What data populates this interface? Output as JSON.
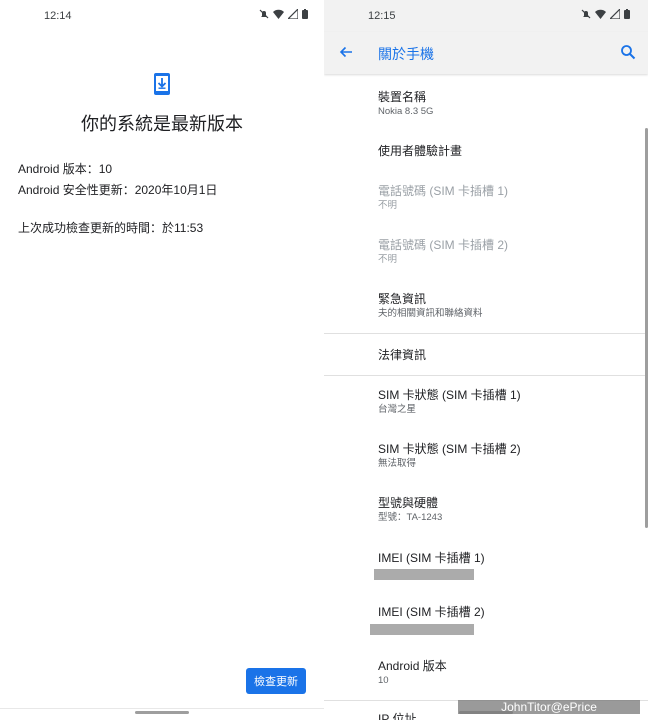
{
  "left": {
    "status": {
      "time": "12:14"
    },
    "title": "你的系統是最新版本",
    "android_version": "Android 版本：10",
    "security_update": "Android 安全性更新：2020年10月1日",
    "last_check": "上次成功檢查更新的時間：於11:53",
    "check_button": "檢查更新"
  },
  "right": {
    "status": {
      "time": "12:15"
    },
    "appbar_title": "關於手機",
    "items": [
      {
        "title": "裝置名稱",
        "subtitle": "Nokia 8.3 5G"
      },
      {
        "title": "使用者體驗計畫",
        "subtitle": ""
      },
      {
        "title": "電話號碼 (SIM 卡插槽 1)",
        "subtitle": "不明"
      },
      {
        "title": "電話號碼 (SIM 卡插槽 2)",
        "subtitle": "不明"
      },
      {
        "title": "緊急資訊",
        "subtitle": "夫的相關資訊和聯絡資料"
      },
      {
        "title": "法律資訊",
        "subtitle": ""
      },
      {
        "title": "SIM 卡狀態 (SIM 卡插槽 1)",
        "subtitle": "台灣之星"
      },
      {
        "title": "SIM 卡狀態 (SIM 卡插槽 2)",
        "subtitle": "無法取得"
      },
      {
        "title": "型號與硬體",
        "subtitle": "型號：TA-1243"
      },
      {
        "title": "IMEI (SIM 卡插槽 1)",
        "subtitle": ""
      },
      {
        "title": "IMEI (SIM 卡插槽 2)",
        "subtitle": ""
      },
      {
        "title": "Android 版本",
        "subtitle": "10"
      },
      {
        "title": "IP 位址",
        "subtitle": ""
      }
    ],
    "watermark": "JohnTitor@ePrice"
  },
  "colors": {
    "accent": "#1a73e8",
    "appbar_bg": "#f2f2f2",
    "redaction": "#ababab"
  }
}
